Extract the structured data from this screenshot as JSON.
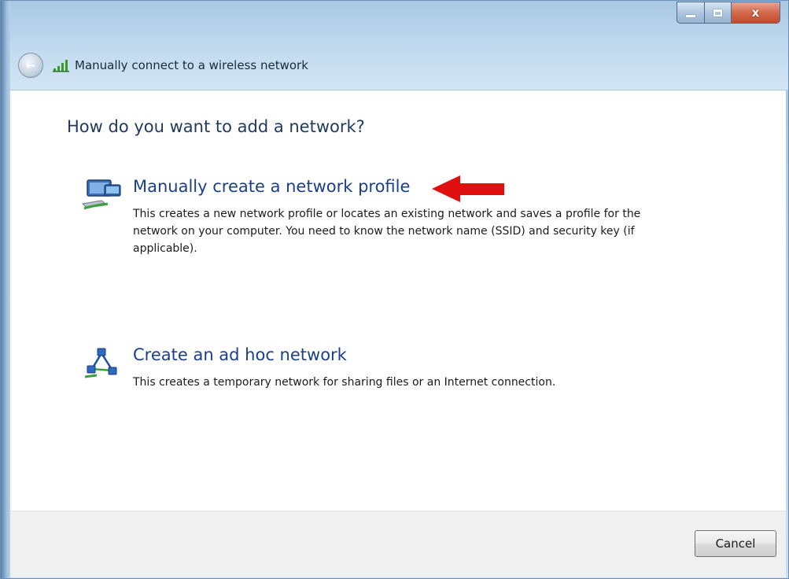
{
  "window": {
    "title": "Manually connect to a wireless network",
    "controls": {
      "close_label": "x"
    }
  },
  "content": {
    "heading": "How do you want to add a network?",
    "options": [
      {
        "title": "Manually create a network profile",
        "description": "This creates a new network profile or locates an existing network and saves a profile for the network on your computer. You need to know the network name (SSID) and security key (if applicable).",
        "icon": "network-profile-icon",
        "highlighted_by_arrow": true
      },
      {
        "title": "Create an ad hoc network",
        "description": "This creates a temporary network for sharing files or an Internet connection.",
        "icon": "ad-hoc-network-icon",
        "highlighted_by_arrow": false
      }
    ]
  },
  "footer": {
    "cancel_label": "Cancel"
  },
  "colors": {
    "arrow": "#e01010",
    "link_title": "#1b3f8a",
    "heading": "#1e3a5f"
  }
}
